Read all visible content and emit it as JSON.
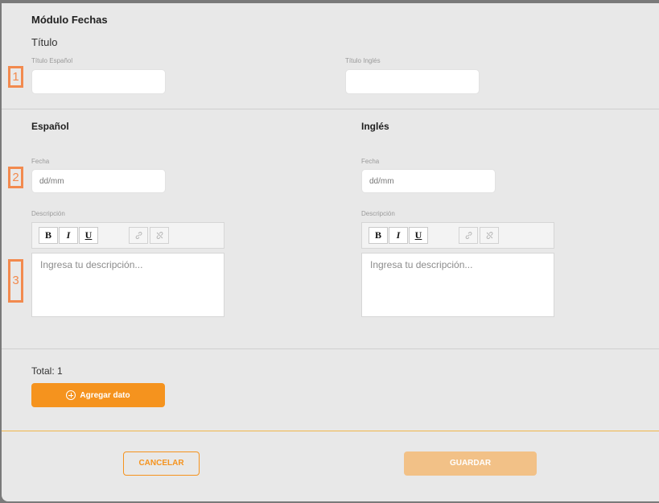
{
  "module": {
    "title": "Módulo Fechas",
    "subtitle": "Título"
  },
  "title_fields": {
    "spanish_label": "Título Español",
    "english_label": "Título Inglés",
    "spanish_value": "",
    "english_value": ""
  },
  "columns": [
    {
      "heading": "Español",
      "date_label": "Fecha",
      "date_placeholder": "dd/mm",
      "description_label": "Descripción",
      "description_placeholder": "Ingresa tu descripción..."
    },
    {
      "heading": "Inglés",
      "date_label": "Fecha",
      "date_placeholder": "dd/mm",
      "description_label": "Descripción",
      "description_placeholder": "Ingresa tu descripción..."
    }
  ],
  "toolbar": {
    "bold": "B",
    "italic": "I",
    "underline": "U"
  },
  "markers": [
    "1",
    "2",
    "3"
  ],
  "total_label": "Total: 1",
  "add_button": "Agregar dato",
  "cancel_button": "CANCELAR",
  "save_button": "GUARDAR",
  "icons": {
    "link": "link-icon",
    "unlink": "unlink-icon",
    "add": "plus-circle-icon"
  },
  "colors": {
    "accent": "#f5931e",
    "save_disabled": "#f2c187",
    "marker": "#f28a4e",
    "modal_bg": "#e8e8e8"
  }
}
